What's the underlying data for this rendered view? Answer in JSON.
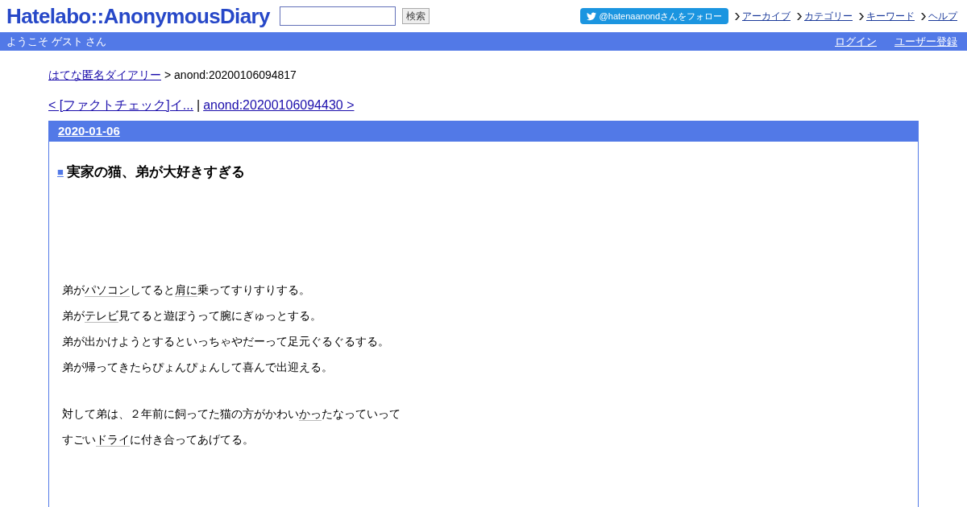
{
  "header": {
    "logo": "Hatelabo::AnonymousDiary",
    "search": {
      "button": "検索"
    },
    "follow_button": "@hatenaanondさんをフォロー",
    "nav_links": [
      "アーカイブ",
      "カテゴリー",
      "キーワード",
      "ヘルプ"
    ]
  },
  "welcome_bar": {
    "greeting": "ようこそ ゲスト さん",
    "links": [
      "ログイン",
      "ユーザー登録"
    ]
  },
  "breadcrumb": {
    "link": "はてな匿名ダイアリー",
    "current": "> anond:20200106094817"
  },
  "pager": {
    "prev": "< [ファクトチェック]イ...",
    "separator": "|",
    "next": "anond:20200106094430 >"
  },
  "entry": {
    "date": "2020-01-06",
    "title_mark": "■",
    "title": "実家の猫、弟が大好きすぎる",
    "paragraphs": [
      [
        [
          {
            "kind": "text",
            "text": "弟が"
          },
          {
            "kind": "keyword",
            "text": "パソコン"
          },
          {
            "kind": "text",
            "text": "してると"
          },
          {
            "kind": "keyword",
            "text": "肩に"
          },
          {
            "kind": "text",
            "text": "乗ってすりすりする。"
          }
        ],
        [
          {
            "kind": "text",
            "text": "弟が"
          },
          {
            "kind": "keyword",
            "text": "テレビ"
          },
          {
            "kind": "text",
            "text": "見てると遊ぼうって腕にぎゅっとする。"
          }
        ],
        [
          {
            "kind": "text",
            "text": "弟が出かけようとするといっちゃやだーって足元ぐるぐるする。"
          }
        ],
        [
          {
            "kind": "text",
            "text": "弟が帰ってきたらぴょんぴょんして喜んで出迎える。"
          }
        ]
      ],
      [
        [
          {
            "kind": "text",
            "text": "対して弟は、２年前に飼ってた猫の方がかわい"
          },
          {
            "kind": "keyword",
            "text": "かっ"
          },
          {
            "kind": "text",
            "text": "たなっていって"
          }
        ],
        [
          {
            "kind": "text",
            "text": "すごい"
          },
          {
            "kind": "keyword",
            "text": "ドライ"
          },
          {
            "kind": "text",
            "text": "に付き合ってあげてる。"
          }
        ]
      ]
    ]
  }
}
